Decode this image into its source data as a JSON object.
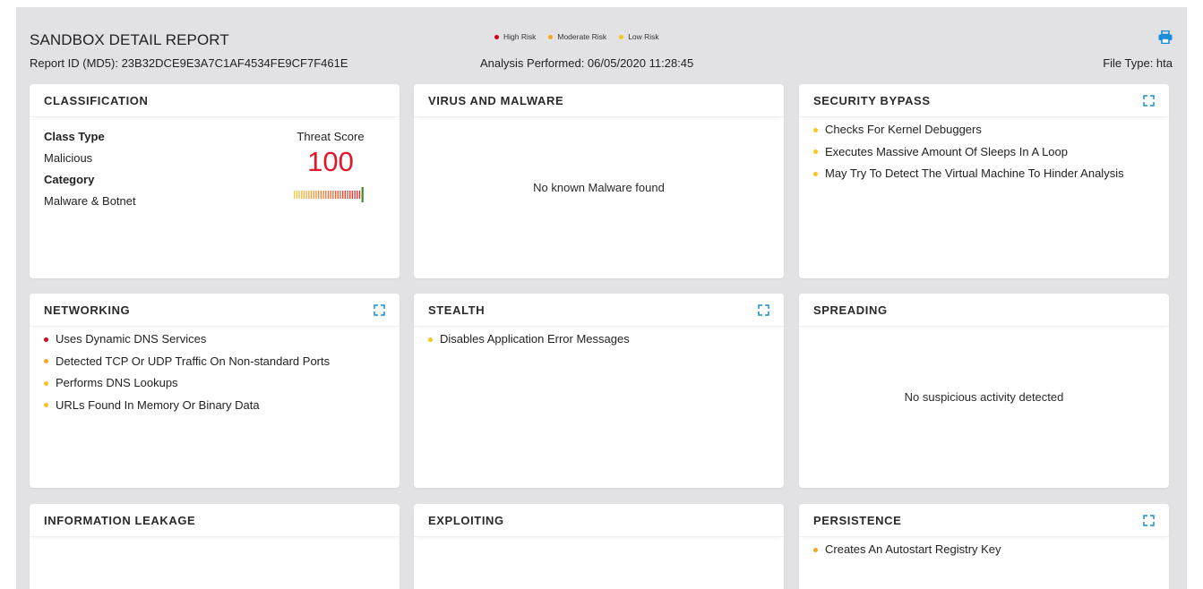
{
  "header": {
    "title": "SANDBOX DETAIL REPORT",
    "report_id": "Report ID (MD5): 23B32DCE9E3A7C1AF4534FE9CF7F461E",
    "analysis": "Analysis Performed: 06/05/2020 11:28:45",
    "file_type": "File Type: hta",
    "print_icon": "printer-icon"
  },
  "legend": [
    {
      "label": "High Risk",
      "color": "#d0021b"
    },
    {
      "label": "Moderate Risk",
      "color": "#f5a623"
    },
    {
      "label": "Low Risk",
      "color": "#f8c51c"
    }
  ],
  "colors": {
    "high": "#d0021b",
    "moderate": "#f5a623",
    "low": "#f8c51c",
    "accent": "#1a8ed8",
    "threat": "#e0182b"
  },
  "cards": {
    "classification": {
      "title": "CLASSIFICATION",
      "class_type_label": "Class Type",
      "class_type_value": "Malicious",
      "category_label": "Category",
      "category_value": "Malware & Botnet",
      "threat_label": "Threat Score",
      "threat_score": "100"
    },
    "virus": {
      "title": "VIRUS AND MALWARE",
      "message": "No known Malware found"
    },
    "security": {
      "title": "SECURITY BYPASS",
      "items": [
        {
          "text": "Checks For Kernel Debuggers",
          "risk": "low"
        },
        {
          "text": "Executes Massive Amount Of Sleeps In A Loop",
          "risk": "low"
        },
        {
          "text": "May Try To Detect The Virtual Machine To Hinder Analysis",
          "risk": "low"
        }
      ]
    },
    "networking": {
      "title": "NETWORKING",
      "items": [
        {
          "text": "Uses Dynamic DNS Services",
          "risk": "high"
        },
        {
          "text": "Detected TCP Or UDP Traffic On Non-standard Ports",
          "risk": "moderate"
        },
        {
          "text": "Performs DNS Lookups",
          "risk": "low"
        },
        {
          "text": "URLs Found In Memory Or Binary Data",
          "risk": "low"
        }
      ]
    },
    "stealth": {
      "title": "STEALTH",
      "items": [
        {
          "text": "Disables Application Error Messages",
          "risk": "low"
        }
      ]
    },
    "spreading": {
      "title": "SPREADING",
      "message": "No suspicious activity detected"
    },
    "leakage": {
      "title": "INFORMATION LEAKAGE"
    },
    "exploiting": {
      "title": "EXPLOITING"
    },
    "persistence": {
      "title": "PERSISTENCE",
      "items": [
        {
          "text": "Creates An Autostart Registry Key",
          "risk": "moderate"
        }
      ]
    }
  }
}
